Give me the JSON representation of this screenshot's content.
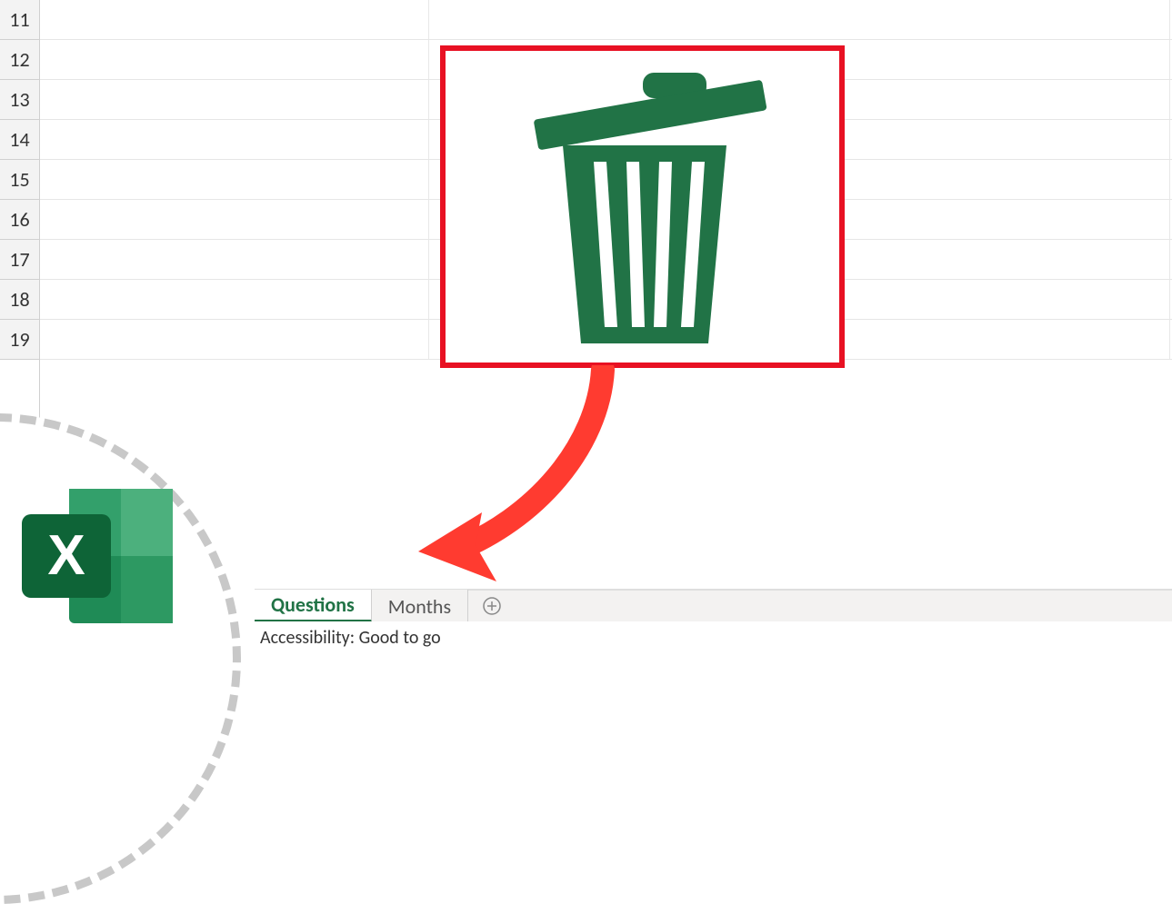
{
  "rows": [
    "11",
    "12",
    "13",
    "14",
    "15",
    "16",
    "17",
    "18",
    "19"
  ],
  "tabs": {
    "active": "Questions",
    "other": "Months"
  },
  "status": {
    "accessibility": "Accessibility: Good to go"
  },
  "icons": {
    "trash": "trash-icon",
    "addSheet": "add-sheet-icon",
    "excelLogo": "excel-logo"
  },
  "colors": {
    "excelGreen": "#217346",
    "highlightRed": "#e81123",
    "arrowRed": "#ff3b30"
  }
}
